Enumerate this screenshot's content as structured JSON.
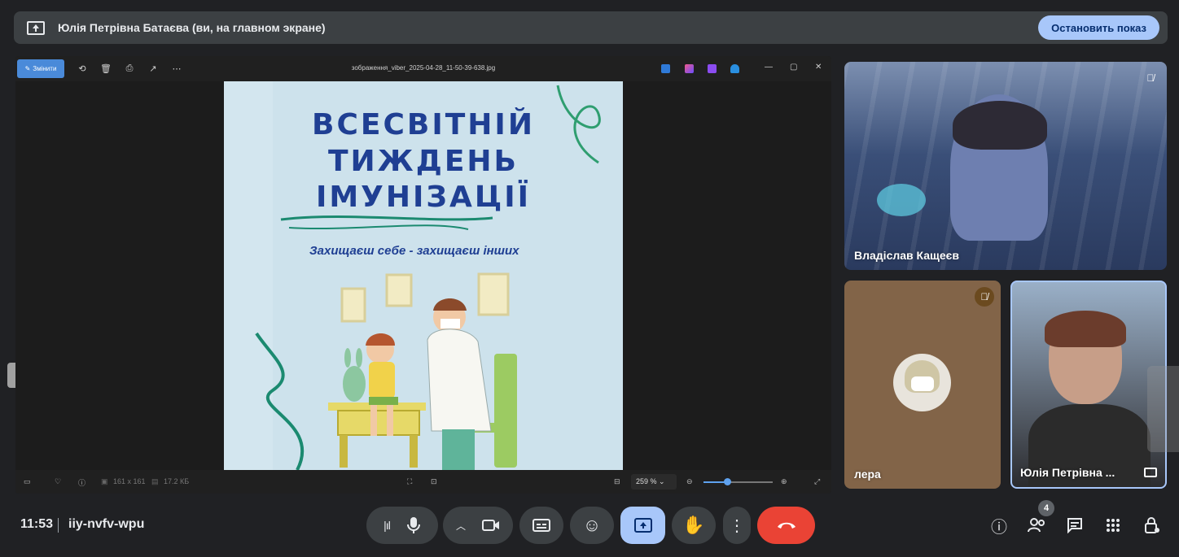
{
  "banner": {
    "title": "Юлія Петрівна Батаєва (ви, на главном экране)",
    "stop_label": "Остановить показ"
  },
  "viewer": {
    "edit_label": "Змінити",
    "file_name": "зображення_viber_2025-04-28_11-50-39-638.jpg",
    "dimensions": "161 x 161",
    "file_size": "17.2 КБ",
    "zoom": "259 %"
  },
  "poster": {
    "title_line1": "ВСЕСВІТНІЙ",
    "title_line2": "ТИЖДЕНЬ",
    "title_line3": "ІМУНІЗАЦІЇ",
    "slogan": "Захищаєш себе - захищаєш інших"
  },
  "participants": [
    {
      "name": "Владіслав Кащеєв",
      "muted": true
    },
    {
      "name": "лера",
      "muted": true
    },
    {
      "name": "Юлія Петрівна ...",
      "muted": false
    }
  ],
  "bottom": {
    "time": "11:53",
    "meeting_code": "iiy-nvfv-wpu",
    "people_count": "4"
  },
  "colors": {
    "accent": "#a8c7fa",
    "end_call": "#ea4335",
    "background": "#202124"
  }
}
